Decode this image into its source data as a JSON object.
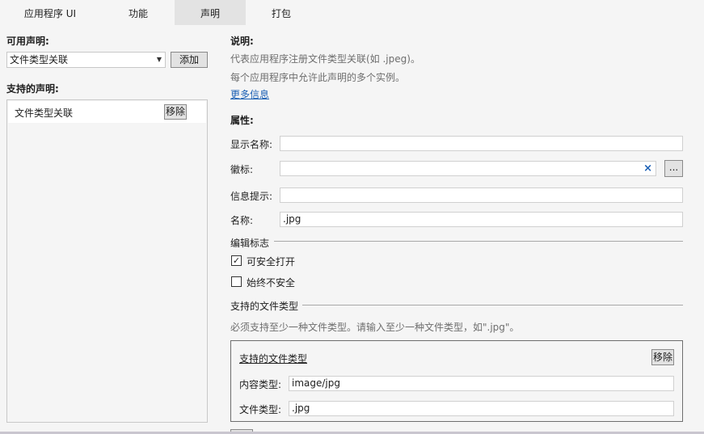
{
  "tabs": [
    {
      "label": "应用程序 UI",
      "active": false
    },
    {
      "label": "功能",
      "active": false
    },
    {
      "label": "声明",
      "active": true
    },
    {
      "label": "打包",
      "active": false
    }
  ],
  "left": {
    "available_label": "可用声明:",
    "dropdown_value": "文件类型关联",
    "add_button": "添加",
    "supported_label": "支持的声明:",
    "supported_items": [
      {
        "label": "文件类型关联",
        "remove": "移除"
      }
    ]
  },
  "right": {
    "desc_title": "说明:",
    "desc_line1": "代表应用程序注册文件类型关联(如 .jpeg)。",
    "desc_line2": "每个应用程序中允许此声明的多个实例。",
    "more_info": "更多信息",
    "props_title": "属性:",
    "display_name_label": "显示名称:",
    "display_name_value": "",
    "logo_label": "徽标:",
    "logo_value": "",
    "logo_clear_icon": "×",
    "logo_browse": "...",
    "tooltip_label": "信息提示:",
    "tooltip_value": "",
    "name_label": "名称:",
    "name_value": ".jpg",
    "edit_flags_title": "编辑标志",
    "open_is_safe": {
      "label": "可安全打开",
      "checked": true
    },
    "always_unsafe": {
      "label": "始终不安全",
      "checked": false
    },
    "supported_types_title": "支持的文件类型",
    "supported_types_hint": "必须支持至少一种文件类型。请输入至少一种文件类型，如\".jpg\"。",
    "file_type_entry": {
      "title": "支持的文件类型",
      "remove": "移除",
      "content_type_label": "内容类型:",
      "content_type_value": "image/jpg",
      "file_type_label": "文件类型:",
      "file_type_value": ".jpg"
    }
  }
}
